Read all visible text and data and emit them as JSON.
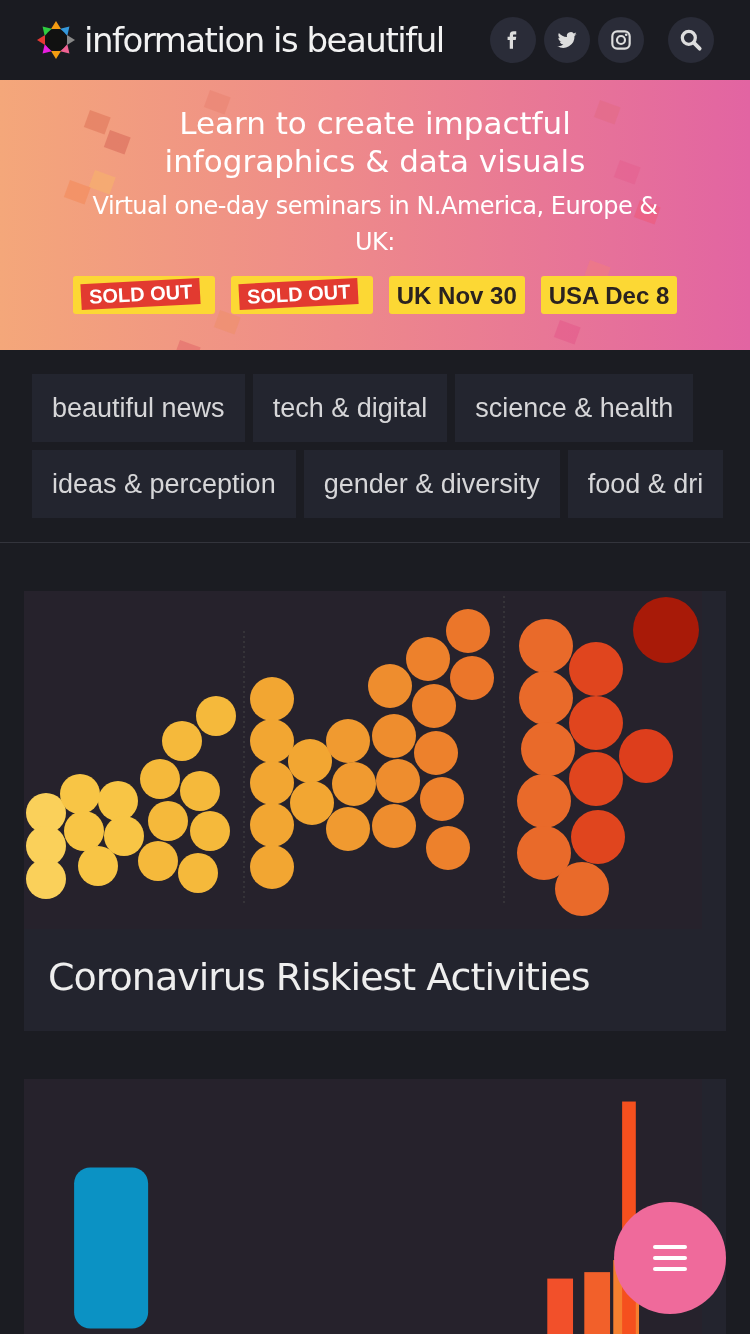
{
  "header": {
    "logo_text": "information is beautiful",
    "social": [
      {
        "kind": "facebook"
      },
      {
        "kind": "twitter"
      },
      {
        "kind": "instagram"
      }
    ]
  },
  "banner": {
    "title": "Learn to create impactful infographics & data visuals",
    "subtitle": "Virtual one-day seminars in N.America, Europe & UK:",
    "dates": [
      {
        "kind": "sold_out",
        "stamp": "SOLD OUT"
      },
      {
        "kind": "sold_out",
        "stamp": "SOLD OUT"
      },
      {
        "kind": "date",
        "label": "UK Nov 30"
      },
      {
        "kind": "date",
        "label": "USA Dec 8"
      }
    ]
  },
  "tag_rows": [
    [
      "beautiful news",
      "tech & digital",
      "science & health"
    ],
    [
      "ideas & perception",
      "gender & diversity",
      "food & dri"
    ]
  ],
  "cards": [
    {
      "kind": "bubbles",
      "title": "Coronavirus Riskiest Activities"
    },
    {
      "kind": "bars"
    }
  ]
}
